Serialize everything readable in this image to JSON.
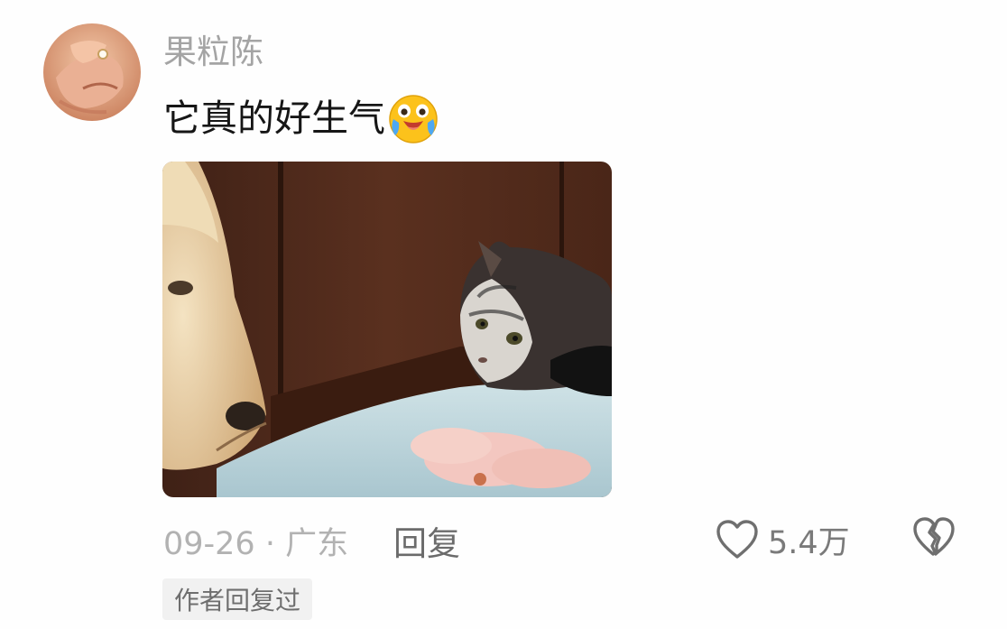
{
  "comment": {
    "username": "果粒陈",
    "text": "它真的好生气",
    "emoji_icon": "crying-laughing-emoji",
    "image_alt": "dog and cat staring at each other",
    "date_location": "09-26 · 广东",
    "reply_label": "回复",
    "like_count": "5.4万",
    "author_replied_badge": "作者回复过"
  },
  "colors": {
    "username": "#a4a4a4",
    "text": "#161616",
    "meta": "#b2b2b2",
    "reply": "#6b6b6b",
    "icon": "#6f6f6f",
    "badge_bg": "#f1f1f1"
  }
}
